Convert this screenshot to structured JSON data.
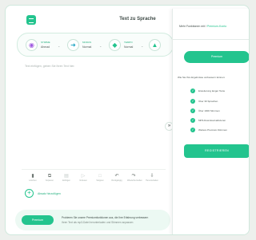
{
  "header": {
    "title": "Text zu Sprache"
  },
  "modes": [
    {
      "label": "STIMME",
      "value": "Ahmad",
      "icon": "voice-icon",
      "color": "#a05be0"
    },
    {
      "label": "MODUS",
      "value": "Normal",
      "icon": "mode-icon",
      "color": "#23a6c4"
    },
    {
      "label": "TEMPO",
      "value": "Normal",
      "icon": "speed-icon",
      "color": "#23c48e"
    },
    {
      "label": "",
      "value": "",
      "icon": "settings-icon",
      "color": "#23c48e"
    }
  ],
  "editor": {
    "placeholder": "Text einfügen, geben Sie Ihren Text hier."
  },
  "toolbar": [
    {
      "label": "Löschen",
      "icon": "trash-icon",
      "glyph": "🗑",
      "faded": false
    },
    {
      "label": "Kopieren",
      "icon": "copy-icon",
      "glyph": "⧉",
      "faded": false
    },
    {
      "label": "Einfügen",
      "icon": "paste-icon",
      "glyph": "▤",
      "faded": true
    },
    {
      "label": "Vorlesen",
      "icon": "play-icon",
      "glyph": "▷",
      "faded": true
    },
    {
      "label": "Stoppen",
      "icon": "stop-icon",
      "glyph": "□",
      "faded": true
    },
    {
      "label": "Rückgängig",
      "icon": "undo-icon",
      "glyph": "↶",
      "faded": false
    },
    {
      "label": "Wiederherstellen",
      "icon": "redo-icon",
      "glyph": "↷",
      "faded": false
    },
    {
      "label": "Herunterladen",
      "icon": "download-icon",
      "glyph": "⇩",
      "faded": false
    }
  ],
  "add_block": {
    "label": "Absatz hinzufügen"
  },
  "upsell": {
    "button": "Premium",
    "line1": "Probieren Sie unsere Premiumfunktionen aus, die Ihre Erfahrung verbessern",
    "line2": "Ihren Text als mp3-Datei herunterladen und Stimmen anpassen"
  },
  "panel": {
    "heading_prefix": "Mehr Funktionen mit",
    "heading_link": "Premium-Konto",
    "premium_button": "Premium",
    "features_intro": "Wie Sie Ihre Ergebnisse verbessern können:",
    "features": [
      "Erweiterung langer Texte",
      "Über 30 Sprachen",
      "Über 1000 Stimmen",
      "MP3-Download aktivieren",
      "Weitere Premium-Stimmen"
    ],
    "register_button": "REGISTRIEREN"
  },
  "colors": {
    "accent": "#23c48e",
    "accent_soft": "#ecf9f3",
    "card_border": "#cfe8dc",
    "background": "#edf0ed"
  }
}
